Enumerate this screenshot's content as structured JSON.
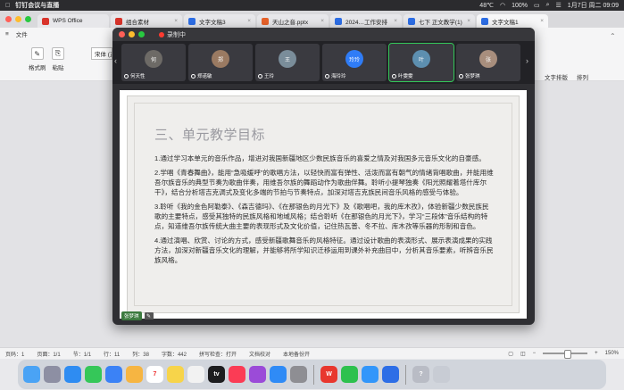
{
  "menubar": {
    "app_name": "钉钉会议与直播",
    "temperature": "48℃",
    "battery": "100%",
    "datetime": "1月7日 周二 09:09"
  },
  "tabs": [
    {
      "label": "WPS Office",
      "color": "#d9342b"
    },
    {
      "label": "组合素材",
      "color": "#d9342b"
    },
    {
      "label": "文字文稿3",
      "color": "#2d6ee6"
    },
    {
      "label": "天山之音.pptx",
      "color": "#e8622a"
    },
    {
      "label": "2024…工作安排",
      "color": "#2d6ee6"
    },
    {
      "label": "七下 正文教学(1)",
      "color": "#2d6ee6"
    },
    {
      "label": "文字文稿1",
      "color": "#2d6ee6"
    }
  ],
  "toolbar": {
    "file_menu": "文件",
    "format_painter": "格式刷",
    "paste": "粘贴",
    "font_name": "宋体 (正",
    "text_layout": "文字排版",
    "arrange": "排列"
  },
  "recording": {
    "title": "录制中"
  },
  "participants": [
    {
      "name": "何天性",
      "initials": "何",
      "color": "#6d6a66"
    },
    {
      "name": "郑诺敏",
      "initials": "郑",
      "color": "#9a7a62"
    },
    {
      "name": "王玲",
      "initials": "王",
      "color": "#7a8d9a"
    },
    {
      "name": "海玲玲",
      "initials": "玲玲",
      "color": "#2f7cf6"
    },
    {
      "name": "叶雯雯",
      "initials": "叶",
      "color": "#5d8fb0"
    },
    {
      "name": "张梦琪",
      "initials": "张",
      "color": "#a88e7d"
    }
  ],
  "slide": {
    "title": "三、单元教学目标",
    "paragraphs": [
      "1.通过学习本单元的音乐作品，增进对我国新疆地区少数民族音乐的喜爱之情及对我国多元音乐文化的自豪感。",
      "2.学唱《青春舞曲》，能用“急吸缓呼”的歌唱方法，以轻快而富有弹性、活泼而富有朝气的情绪背唱歌曲，并能用维吾尔族音乐的典型节奏为歌曲伴奏，用维吾尔族的舞蹈动作为歌曲伴舞。聆听小提琴独奏《阳光照耀着塔什库尔干》，结合分析塔吉克调式及变化多端的节拍与节奏特点，加深对塔吉克族民间音乐风格的感受与体验。",
      "3.聆听《我的金色阿勒泰》、《森吉德玛》、《在那银色的月光下》及《歌唱吧，我的库木孜》，体验新疆少数民族民歌的主要特点，感受其独特的民族风格和地域风格；结合聆听《在那银色的月光下》，学习“三段体”音乐结构的特点，知道维吾尔族传统大曲主要的表现形式及文化价值，记住热瓦普、冬不拉、库木孜等乐器的形制和音色。",
      "4.通过演唱、欣赏、讨论的方式，感受新疆歌舞音乐的风格特征。通过设计歌曲的表演形式、展示表演成果的实践方法，加深对新疆音乐文化的理解，并能够将所学知识迁移运用到课外补充曲目中，分析其音乐要素，听辨音乐民族风格。"
    ],
    "presenter_label": "张梦琪"
  },
  "statusbar": {
    "page": "页码：1",
    "pages": "页面：1/1",
    "section": "节：1/1",
    "row": "行：11",
    "col": "列：38",
    "words": "字数：442",
    "spell": "拼写检查：打开",
    "proof": "文档校对",
    "font_missing": "本地备份开",
    "zoom": "150%"
  },
  "dock": [
    {
      "name": "finder",
      "color": "#4aa3f5",
      "label": ""
    },
    {
      "name": "launchpad",
      "color": "#8d8fa3",
      "label": ""
    },
    {
      "name": "safari",
      "color": "#2e8cf2",
      "label": ""
    },
    {
      "name": "messages",
      "color": "#35c759",
      "label": ""
    },
    {
      "name": "mail",
      "color": "#3b82f6",
      "label": ""
    },
    {
      "name": "photos",
      "color": "#f6b542",
      "label": ""
    },
    {
      "name": "calendar",
      "color": "#ffffff",
      "label": "7"
    },
    {
      "name": "notes",
      "color": "#f7d44a",
      "label": ""
    },
    {
      "name": "reminders",
      "color": "#f2f2f2",
      "label": ""
    },
    {
      "name": "tv",
      "color": "#1d1d1f",
      "label": "tv"
    },
    {
      "name": "music",
      "color": "#fb3c55",
      "label": ""
    },
    {
      "name": "podcasts",
      "color": "#9b4bd8",
      "label": ""
    },
    {
      "name": "app-store",
      "color": "#2f8bf6",
      "label": ""
    },
    {
      "name": "settings",
      "color": "#8e8e93",
      "label": ""
    },
    {
      "name": "wps",
      "color": "#e8372e",
      "label": "W"
    },
    {
      "name": "wechat",
      "color": "#2dc14e",
      "label": ""
    },
    {
      "name": "dingtalk",
      "color": "#3296fa",
      "label": ""
    },
    {
      "name": "tencent-meeting",
      "color": "#2d6ee6",
      "label": ""
    },
    {
      "name": "help",
      "color": "#b9bcc5",
      "label": "?"
    },
    {
      "name": "trash",
      "color": "#c8ccd4",
      "label": ""
    }
  ]
}
